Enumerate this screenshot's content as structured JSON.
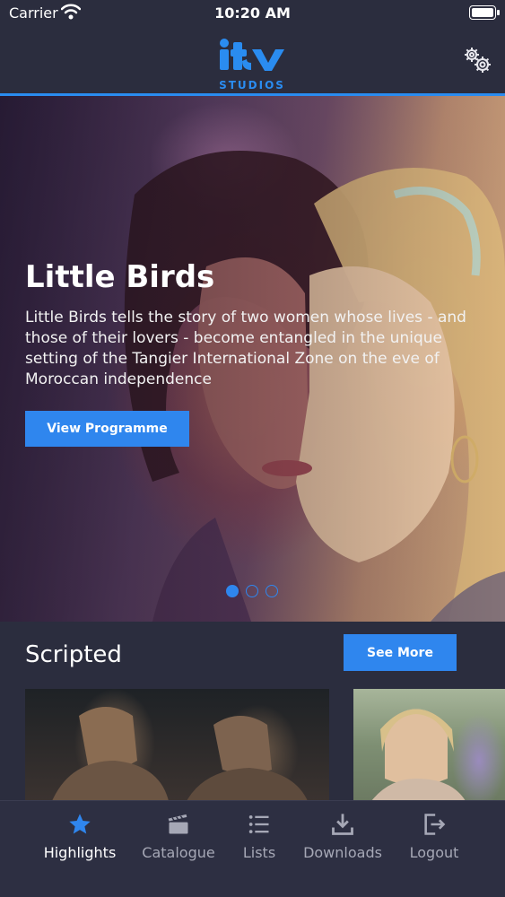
{
  "status_bar": {
    "carrier": "Carrier",
    "time": "10:20 AM"
  },
  "header": {
    "logo_main": "itv",
    "logo_sub": "STUDIOS",
    "accent_color": "#2a8cf0"
  },
  "hero": {
    "title": "Little Birds",
    "description": "Little Birds tells the story of two women whose lives - and those of their lovers - become entangled in the unique setting of the Tangier International Zone on the eve of Moroccan independence",
    "button_label": "View Programme",
    "pager": {
      "count": 3,
      "active_index": 0
    }
  },
  "section": {
    "title": "Scripted",
    "see_more_label": "See More"
  },
  "tabbar": {
    "items": [
      {
        "label": "Highlights",
        "icon": "star-icon",
        "active": true
      },
      {
        "label": "Catalogue",
        "icon": "clapperboard-icon",
        "active": false
      },
      {
        "label": "Lists",
        "icon": "list-icon",
        "active": false
      },
      {
        "label": "Downloads",
        "icon": "download-icon",
        "active": false
      },
      {
        "label": "Logout",
        "icon": "logout-icon",
        "active": false
      }
    ]
  }
}
